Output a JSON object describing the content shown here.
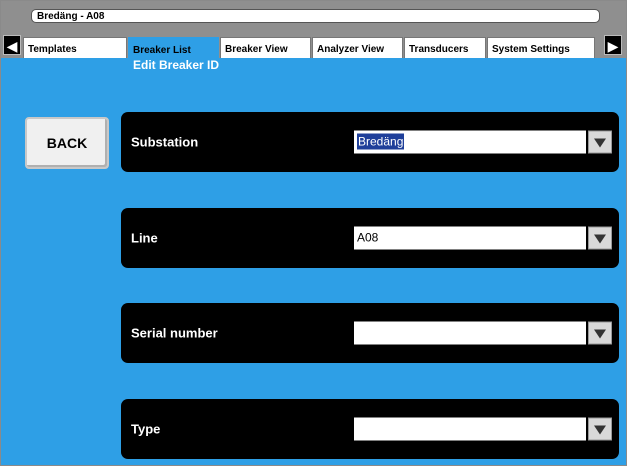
{
  "window": {
    "title": "Bredäng - A08"
  },
  "tabs": [
    {
      "label": "Templates",
      "active": false
    },
    {
      "label": "Breaker List",
      "active": true
    },
    {
      "label": "Breaker View",
      "active": false
    },
    {
      "label": "Analyzer View",
      "active": false
    },
    {
      "label": "Transducers",
      "active": false
    },
    {
      "label": "System Settings",
      "active": false
    }
  ],
  "page": {
    "subtitle": "Edit Breaker ID"
  },
  "back_button": {
    "label": "BACK"
  },
  "fields": [
    {
      "label": "Substation",
      "value": "Bredäng",
      "selected": true
    },
    {
      "label": "Line",
      "value": "A08",
      "selected": false
    },
    {
      "label": "Serial number",
      "value": "",
      "selected": false
    },
    {
      "label": "Type",
      "value": "",
      "selected": false
    }
  ],
  "icons": {
    "tab_left": "left-arrow-icon",
    "tab_right": "right-arrow-icon",
    "dropdown": "dropdown-arrow-icon"
  },
  "colors": {
    "accent": "#2e9fe6",
    "panel": "#000000",
    "chrome": "#8f8f8f"
  }
}
